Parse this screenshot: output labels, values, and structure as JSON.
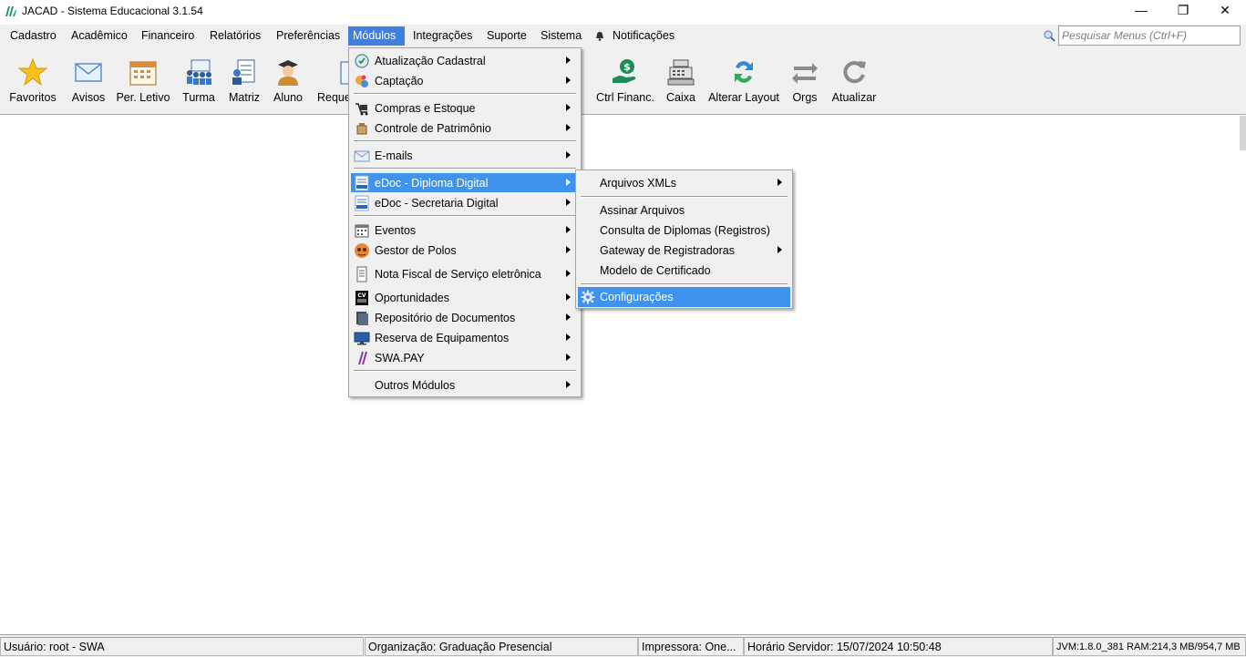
{
  "window": {
    "title": "JACAD - Sistema Educacional 3.1.54",
    "minimize_glyph": "—",
    "restore_glyph": "❐",
    "close_glyph": "✕"
  },
  "menubar": {
    "items": [
      "Cadastro",
      "Acadêmico",
      "Financeiro",
      "Relatórios",
      "Preferências",
      "Módulos",
      "Integrações",
      "Suporte",
      "Sistema"
    ],
    "active": "Módulos",
    "notifications": "Notificações",
    "search_placeholder": "Pesquisar Menus (Ctrl+F)"
  },
  "toolbar": {
    "items": [
      {
        "label": "Favoritos",
        "icon": "star-icon"
      },
      {
        "label": "Avisos",
        "icon": "envelope-icon"
      },
      {
        "label": "Per. Letivo",
        "icon": "calendar-icon"
      },
      {
        "label": "Turma",
        "icon": "class-group-icon"
      },
      {
        "label": "Matriz",
        "icon": "curriculum-icon"
      },
      {
        "label": "Aluno",
        "icon": "student-icon"
      },
      {
        "label": "Reque",
        "icon": "request-icon"
      },
      {
        "label": "Ctrl Financ.",
        "icon": "money-hand-icon"
      },
      {
        "label": "Caixa",
        "icon": "cash-register-icon"
      },
      {
        "label": "Alterar Layout",
        "icon": "swap-layout-icon"
      },
      {
        "label": "Orgs",
        "icon": "orgs-arrows-icon"
      },
      {
        "label": "Atualizar",
        "icon": "refresh-icon"
      }
    ]
  },
  "modulos_menu": {
    "items": [
      {
        "label": "Atualização Cadastral",
        "icon": "update-register-icon",
        "submenu": true
      },
      {
        "label": "Captação",
        "icon": "capture-icon",
        "submenu": true
      },
      {
        "label": "Compras e Estoque",
        "icon": "purchases-icon",
        "submenu": true
      },
      {
        "label": "Controle de Patrimônio",
        "icon": "patrimony-icon",
        "submenu": true
      },
      {
        "label": "E-mails",
        "icon": "email-icon",
        "submenu": true
      },
      {
        "label": "eDoc - Diploma Digital",
        "icon": "edoc-diploma-icon",
        "submenu": true,
        "highlighted": true
      },
      {
        "label": "eDoc - Secretaria Digital",
        "icon": "edoc-secretaria-icon",
        "submenu": true
      },
      {
        "label": "Eventos",
        "icon": "events-calendar-icon",
        "submenu": true
      },
      {
        "label": "Gestor de Polos",
        "icon": "polos-icon",
        "submenu": true
      },
      {
        "label": "Nota Fiscal de Serviço eletrônica",
        "icon": "invoice-icon",
        "submenu": true
      },
      {
        "label": "Oportunidades",
        "icon": "cv-icon",
        "submenu": true
      },
      {
        "label": "Repositório de Documentos",
        "icon": "document-repo-icon",
        "submenu": true
      },
      {
        "label": "Reserva de Equipamentos",
        "icon": "monitor-icon",
        "submenu": true
      },
      {
        "label": "SWA.PAY",
        "icon": "swapay-icon",
        "submenu": true
      },
      {
        "label": "Outros Módulos",
        "icon": "",
        "submenu": true
      }
    ]
  },
  "edoc_submenu": {
    "items": [
      {
        "label": "Arquivos XMLs",
        "submenu": true
      },
      {
        "label": "Assinar Arquivos"
      },
      {
        "label": "Consulta de Diplomas (Registros)"
      },
      {
        "label": "Gateway de Registradoras",
        "submenu": true
      },
      {
        "label": "Modelo de Certificado"
      },
      {
        "label": "Configurações",
        "icon": "gear-icon",
        "highlighted": true
      }
    ]
  },
  "statusbar": {
    "usuario": "Usuário: root - SWA",
    "organizacao": "Organização: Graduação Presencial",
    "impressora": "Impressora: One...",
    "horario": "Horário Servidor: 15/07/2024 10:50:48",
    "jvm": "JVM:1.8.0_381  RAM:214,3 MB/954,7 MB"
  },
  "colors": {
    "accent": "#3f93ec",
    "menu_active": "#3f7fe0",
    "chrome": "#f0f0f0"
  }
}
